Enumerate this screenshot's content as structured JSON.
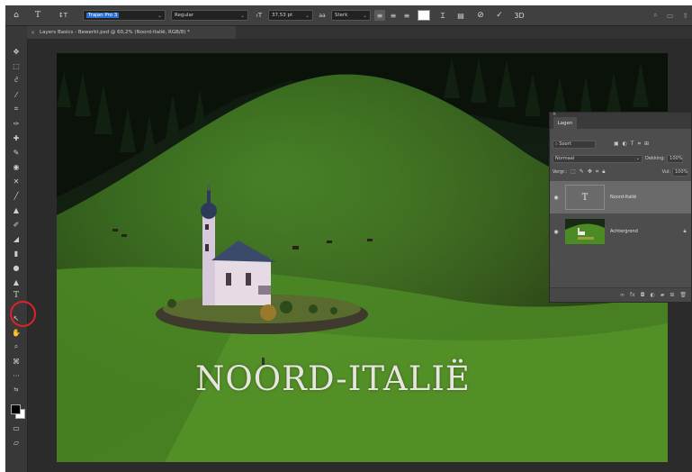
{
  "options_bar": {
    "home_icon": "home-icon",
    "font_family": "Trajan Pro 3",
    "font_style": "Regular",
    "font_size": "37,53 pt",
    "anti_alias": "Sterk",
    "aa_prefix": "aa"
  },
  "document_tab": {
    "close": "×",
    "title": "Layers Basics - Bewerkt.psd @ 60,2% (Noord-Italië, RGB/8) *"
  },
  "canvas": {
    "overlay_text": "NOORD-ITALIË"
  },
  "layers_panel": {
    "tab_label": "Lagen",
    "close": "×",
    "search_placeholder": "Soort",
    "blend_mode": "Normaal",
    "opacity_label": "Dekking:",
    "opacity_value": "100%",
    "lock_label": "Vergr.:",
    "fill_label": "Vul:",
    "fill_value": "100%",
    "layers": [
      {
        "name": "Noord-Italië",
        "thumb": "T",
        "active": true
      },
      {
        "name": "Achtergrond",
        "locked": true,
        "active": false
      }
    ]
  },
  "colors": {
    "highlight_circle": "#e0202a",
    "selected_font": "#2d6fcf"
  }
}
